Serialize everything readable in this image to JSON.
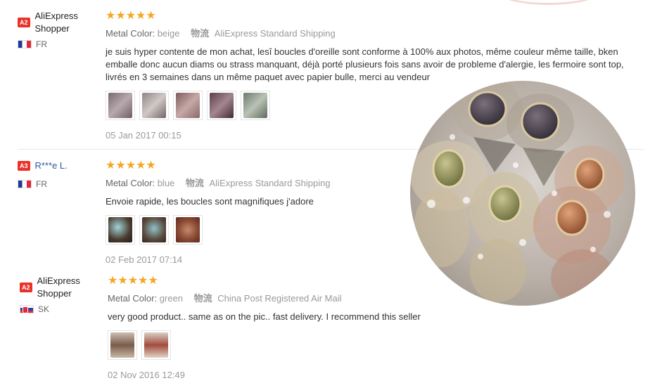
{
  "reviews": [
    {
      "level": "A2",
      "name": "AliExpress Shopper",
      "country": "FR",
      "stars": "★★★★★",
      "color_label": "Metal Color:",
      "color_value": "beige",
      "ship_icon": "物流",
      "shipping": "AliExpress Standard Shipping",
      "text": "je suis hyper contente de mon achat, lesî boucles d'oreille sont conforme à 100% aux photos, même couleur même taille, bken emballe donc aucun diams ou strass manquant, déjà porté plusieurs fois sans avoir de probleme d'alergie, les fermoire sont top, livrés en 3 semaines dans un même paquet avec papier bulle, merci au vendeur",
      "date": "05 Jan 2017 00:15"
    },
    {
      "level": "A3",
      "name": "R***e L.",
      "country": "FR",
      "stars": "★★★★★",
      "color_label": "Metal Color:",
      "color_value": "blue",
      "ship_icon": "物流",
      "shipping": "AliExpress Standard Shipping",
      "text": "Envoie rapide, les boucles sont magnifiques j'adore",
      "date": "02 Feb 2017 07:14"
    },
    {
      "level": "A2",
      "name": "AliExpress Shopper",
      "country": "SK",
      "stars": "★★★★★",
      "color_label": "Metal Color:",
      "color_value": "green",
      "ship_icon": "物流",
      "shipping": "China Post Registered Air Mail",
      "text": "very good product.. same as on the pic.. fast delivery. I recommend this seller",
      "date": "02 Nov 2016 12:49"
    }
  ]
}
